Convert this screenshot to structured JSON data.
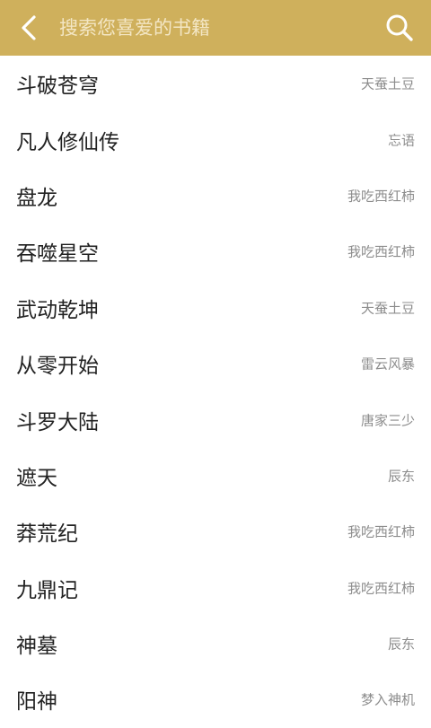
{
  "header": {
    "back_icon": "chevron-left-icon",
    "search_placeholder": "搜索您喜爱的书籍",
    "search_value": "",
    "search_icon": "search-icon",
    "background_color": "#cfb05c"
  },
  "books": [
    {
      "title": "斗破苍穹",
      "author": "天蚕土豆"
    },
    {
      "title": "凡人修仙传",
      "author": "忘语"
    },
    {
      "title": "盘龙",
      "author": "我吃西红柿"
    },
    {
      "title": "吞噬星空",
      "author": "我吃西红柿"
    },
    {
      "title": "武动乾坤",
      "author": "天蚕土豆"
    },
    {
      "title": "从零开始",
      "author": "雷云风暴"
    },
    {
      "title": "斗罗大陆",
      "author": "唐家三少"
    },
    {
      "title": "遮天",
      "author": "辰东"
    },
    {
      "title": "莽荒纪",
      "author": "我吃西红柿"
    },
    {
      "title": "九鼎记",
      "author": "我吃西红柿"
    },
    {
      "title": "神墓",
      "author": "辰东"
    },
    {
      "title": "阳神",
      "author": "梦入神机"
    }
  ]
}
